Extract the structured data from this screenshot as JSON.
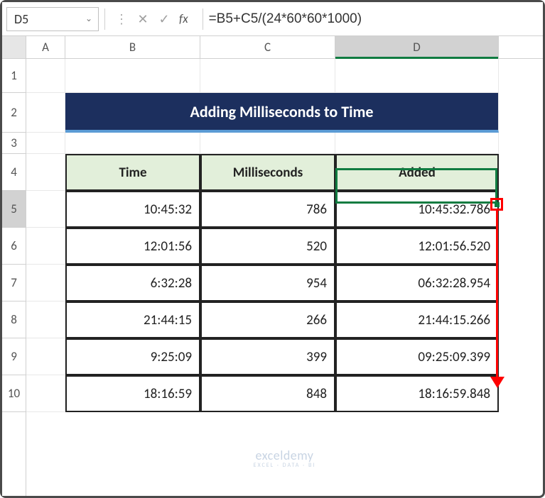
{
  "nameBox": "D5",
  "formula": "=B5+C5/(24*60*60*1000)",
  "fxLabel": "fx",
  "columns": [
    "A",
    "B",
    "C",
    "D"
  ],
  "rows": [
    "1",
    "2",
    "3",
    "4",
    "5",
    "6",
    "7",
    "8",
    "9",
    "10"
  ],
  "colWidths": {
    "A": 55,
    "B": 190,
    "C": 190,
    "D": 230
  },
  "rowHeights": {
    "1": 48,
    "2": 56,
    "3": 30,
    "4": 52,
    "5": 52,
    "6": 52,
    "7": 52,
    "8": 52,
    "9": 52,
    "10": 52
  },
  "selectedCol": "D",
  "selectedRow": "5",
  "title": "Adding Milliseconds to Time",
  "headers": {
    "time": "Time",
    "ms": "Milliseconds",
    "added": "Added"
  },
  "table": [
    {
      "time": "10:45:32",
      "ms": "786",
      "added": "10:45:32.786"
    },
    {
      "time": "12:01:56",
      "ms": "520",
      "added": "12:01:56.520"
    },
    {
      "time": "6:32:28",
      "ms": "954",
      "added": "06:32:28.954"
    },
    {
      "time": "21:44:15",
      "ms": "266",
      "added": "21:44:15.266"
    },
    {
      "time": "9:25:09",
      "ms": "399",
      "added": "09:25:09.399"
    },
    {
      "time": "18:16:59",
      "ms": "848",
      "added": "18:16:59.848"
    }
  ],
  "watermark": {
    "main": "exceldemy",
    "sub": "EXCEL · DATA · BI"
  },
  "chart_data": {
    "type": "table",
    "title": "Adding Milliseconds to Time",
    "columns": [
      "Time",
      "Milliseconds",
      "Added"
    ],
    "rows": [
      [
        "10:45:32",
        786,
        "10:45:32.786"
      ],
      [
        "12:01:56",
        520,
        "12:01:56.520"
      ],
      [
        "6:32:28",
        954,
        "06:32:28.954"
      ],
      [
        "21:44:15",
        266,
        "21:44:15.266"
      ],
      [
        "9:25:09",
        399,
        "09:25:09.399"
      ],
      [
        "18:16:59",
        848,
        "18:16:59.848"
      ]
    ]
  }
}
